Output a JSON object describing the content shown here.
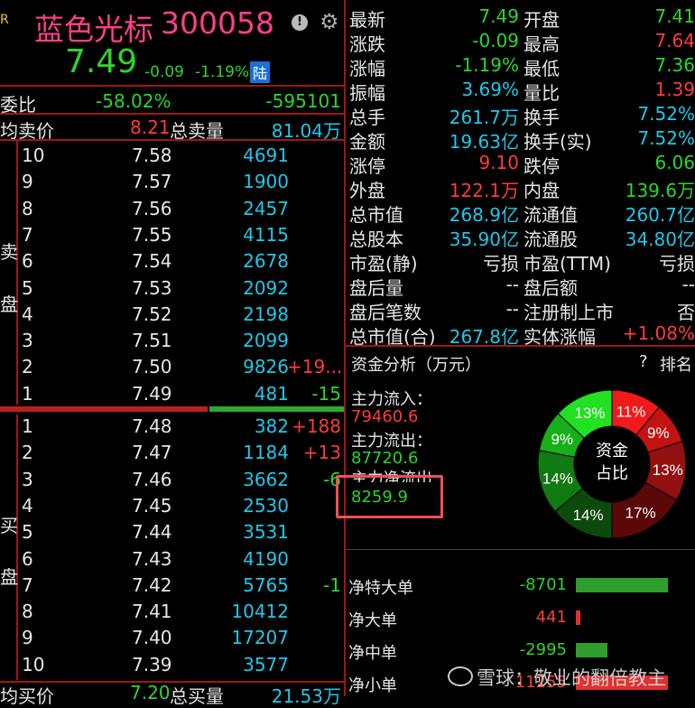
{
  "header": {
    "r_mark": "R",
    "name": "蓝色光标",
    "code": "300058",
    "info_icon": "info-icon",
    "gear_icon": "gear-icon",
    "price": "7.49",
    "change": "-0.09",
    "change_pct": "-1.19%",
    "badge": "陆"
  },
  "weibi": {
    "label": "委比",
    "pct": "-58.02%",
    "diff": "-595101"
  },
  "avg_sell": {
    "label": "均卖价",
    "value": "8.21",
    "total_label": "总卖量",
    "total": "81.04万"
  },
  "avg_buy": {
    "label": "均买价",
    "value": "7.20",
    "total_label": "总买量",
    "total": "21.53万"
  },
  "sell_label": [
    "卖",
    "盘"
  ],
  "buy_label": [
    "买",
    "盘"
  ],
  "sell_rows": [
    {
      "lvl": "10",
      "price": "7.58",
      "vol": "4691",
      "chg": ""
    },
    {
      "lvl": "9",
      "price": "7.57",
      "vol": "1900",
      "chg": ""
    },
    {
      "lvl": "8",
      "price": "7.56",
      "vol": "2457",
      "chg": ""
    },
    {
      "lvl": "7",
      "price": "7.55",
      "vol": "4115",
      "chg": ""
    },
    {
      "lvl": "6",
      "price": "7.54",
      "vol": "2678",
      "chg": ""
    },
    {
      "lvl": "5",
      "price": "7.53",
      "vol": "2092",
      "chg": ""
    },
    {
      "lvl": "4",
      "price": "7.52",
      "vol": "2198",
      "chg": ""
    },
    {
      "lvl": "3",
      "price": "7.51",
      "vol": "2099",
      "chg": ""
    },
    {
      "lvl": "2",
      "price": "7.50",
      "vol": "9826",
      "chg": "+19..."
    },
    {
      "lvl": "1",
      "price": "7.49",
      "vol": "481",
      "chg": "-15"
    }
  ],
  "buy_rows": [
    {
      "lvl": "1",
      "price": "7.48",
      "vol": "382",
      "chg": "+188"
    },
    {
      "lvl": "2",
      "price": "7.47",
      "vol": "1184",
      "chg": "+13"
    },
    {
      "lvl": "3",
      "price": "7.46",
      "vol": "3662",
      "chg": "-6"
    },
    {
      "lvl": "4",
      "price": "7.45",
      "vol": "2530",
      "chg": ""
    },
    {
      "lvl": "5",
      "price": "7.44",
      "vol": "3531",
      "chg": ""
    },
    {
      "lvl": "6",
      "price": "7.43",
      "vol": "4190",
      "chg": ""
    },
    {
      "lvl": "7",
      "price": "7.42",
      "vol": "5765",
      "chg": "-1"
    },
    {
      "lvl": "8",
      "price": "7.41",
      "vol": "10412",
      "chg": ""
    },
    {
      "lvl": "9",
      "price": "7.40",
      "vol": "17207",
      "chg": ""
    },
    {
      "lvl": "10",
      "price": "7.39",
      "vol": "3577",
      "chg": ""
    }
  ],
  "stats": [
    {
      "l1": "最新",
      "v1": "7.49",
      "c1": "grn",
      "l2": "开盘",
      "v2": "7.41",
      "c2": "grn"
    },
    {
      "l1": "涨跌",
      "v1": "-0.09",
      "c1": "grn",
      "l2": "最高",
      "v2": "7.64",
      "c2": "red"
    },
    {
      "l1": "涨幅",
      "v1": "-1.19%",
      "c1": "grn",
      "l2": "最低",
      "v2": "7.36",
      "c2": "grn"
    },
    {
      "l1": "振幅",
      "v1": "3.69%",
      "c1": "cyn",
      "l2": "量比",
      "v2": "1.39",
      "c2": "red"
    },
    {
      "l1": "总手",
      "v1": "261.7万",
      "c1": "cyn",
      "l2": "换手",
      "v2": "7.52%",
      "c2": "cyn"
    },
    {
      "l1": "金额",
      "v1": "19.63亿",
      "c1": "cyn",
      "l2": "换手(实)",
      "v2": "7.52%",
      "c2": "cyn"
    },
    {
      "l1": "涨停",
      "v1": "9.10",
      "c1": "red",
      "l2": "跌停",
      "v2": "6.06",
      "c2": "grn"
    },
    {
      "l1": "外盘",
      "v1": "122.1万",
      "c1": "red",
      "l2": "内盘",
      "v2": "139.6万",
      "c2": "grn"
    },
    {
      "l1": "总市值",
      "v1": "268.9亿",
      "c1": "cyn",
      "l2": "流通值",
      "v2": "260.7亿",
      "c2": "cyn"
    },
    {
      "l1": "总股本",
      "v1": "35.90亿",
      "c1": "cyn",
      "l2": "流通股",
      "v2": "34.80亿",
      "c2": "cyn"
    },
    {
      "l1": "市盈(静)",
      "v1": "亏损",
      "c1": "wht",
      "l2": "市盈(TTM)",
      "v2": "亏损",
      "c2": "wht"
    },
    {
      "l1": "盘后量",
      "v1": "--",
      "c1": "wht",
      "l2": "盘后额",
      "v2": "--",
      "c2": "wht"
    },
    {
      "l1": "盘后笔数",
      "v1": "--",
      "c1": "wht",
      "l2": "注册制上市",
      "v2": "否",
      "c2": "wht"
    },
    {
      "l1": "总市值(合)",
      "v1": "267.8亿",
      "c1": "cyn",
      "l2": "实体涨幅",
      "v2": "+1.08%",
      "c2": "red"
    }
  ],
  "capital": {
    "title": "资金分析（万元）",
    "help": "?",
    "rank": "排名",
    "inflow_label": "主力流入：",
    "inflow": "79460.6",
    "outflow_label": "主力流出：",
    "outflow": "87720.6",
    "net_label": "主力净流出",
    "net": "8259.9",
    "donut_center": [
      "资金",
      "占比"
    ],
    "donut": [
      {
        "label": "11%",
        "pct": 11,
        "color": "#f01a1a"
      },
      {
        "label": "9%",
        "pct": 9,
        "color": "#c41212"
      },
      {
        "label": "13%",
        "pct": 13,
        "color": "#941010"
      },
      {
        "label": "17%",
        "pct": 17,
        "color": "#5a0808"
      },
      {
        "label": "14%",
        "pct": 14,
        "color": "#0c4a0c"
      },
      {
        "label": "14%",
        "pct": 14,
        "color": "#117a11"
      },
      {
        "label": "9%",
        "pct": 9,
        "color": "#18b018"
      },
      {
        "label": "13%",
        "pct": 13,
        "color": "#22e022"
      }
    ]
  },
  "flows": [
    {
      "label": "净特大单",
      "value": "-8701",
      "color": "grn",
      "frac": 1.0,
      "bar": "#2e9e2e"
    },
    {
      "label": "净大单",
      "value": "441",
      "color": "red",
      "frac": 0.05,
      "bar": "#e03030"
    },
    {
      "label": "净中单",
      "value": "-2995",
      "color": "grn",
      "frac": 0.34,
      "bar": "#2e9e2e"
    },
    {
      "label": "净小单",
      "value": "11255",
      "color": "red",
      "frac": 1.0,
      "bar": "#e03030"
    }
  ],
  "watermark": "雪球：敬业的翻倍教主"
}
